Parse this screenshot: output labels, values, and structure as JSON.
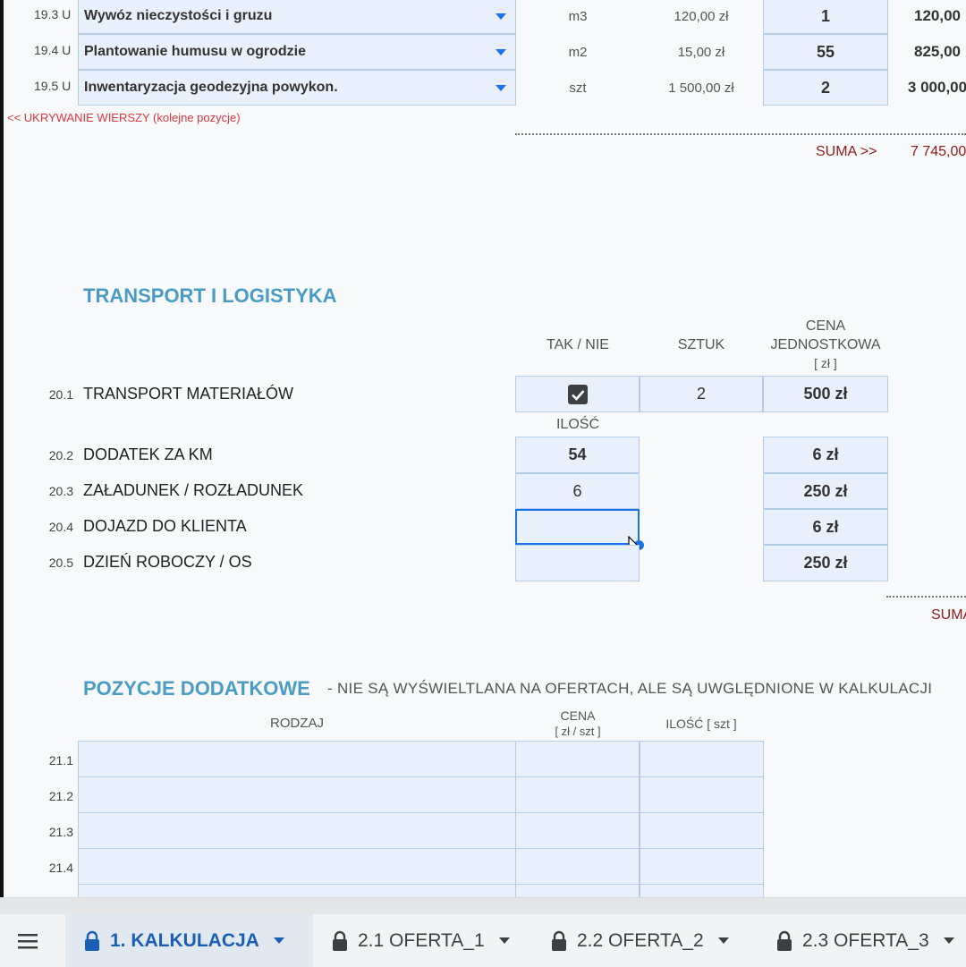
{
  "upper_rows": [
    {
      "num": "19.3 U",
      "name": "Wywóz nieczystości i gruzu",
      "unit": "m3",
      "price": "120,00 zł",
      "qty": "1",
      "total": "120,00"
    },
    {
      "num": "19.4 U",
      "name": "Plantowanie humusu w ogrodzie",
      "unit": "m2",
      "price": "15,00 zł",
      "qty": "55",
      "total": "825,00"
    },
    {
      "num": "19.5 U",
      "name": "Inwentaryzacja geodezyjna powykon.",
      "unit": "szt",
      "price": "1 500,00 zł",
      "qty": "2",
      "total": "3 000,00"
    }
  ],
  "hide_rows_label": "<< UKRYWANIE WIERSZY (kolejne pozycje)",
  "suma_label": "SUMA >>",
  "suma_value": "7 745,00",
  "transport": {
    "title": "TRANSPORT I LOGISTYKA",
    "col_tak_nie": "TAK / NIE",
    "col_sztuk": "SZTUK",
    "col_cena_1": "CENA",
    "col_cena_2": "JEDNOSTKOWA",
    "col_cena_3": "[ zł ]",
    "col_ilosc": "ILOŚĆ",
    "rows": [
      {
        "num": "20.1",
        "name": "TRANSPORT MATERIAŁÓW",
        "checked": true,
        "sztuk": "2",
        "cena": "500 zł"
      },
      {
        "num": "20.2",
        "name": "DODATEK ZA KM",
        "ilosc": "54",
        "cena": "6 zł"
      },
      {
        "num": "20.3",
        "name": "ZAŁADUNEK / ROZŁADUNEK",
        "ilosc": "6",
        "cena": "250 zł"
      },
      {
        "num": "20.4",
        "name": "DOJAZD DO KLIENTA",
        "ilosc": "",
        "cena": "6 zł"
      },
      {
        "num": "20.5",
        "name": "DZIEŃ ROBOCZY / OS",
        "ilosc": "",
        "cena": "250 zł"
      }
    ],
    "suma_label": "SUMA"
  },
  "extra": {
    "title": "POZYCJE DODATKOWE",
    "subtitle": "- NIE SĄ WYŚWIELTLANA NA OFERTACH, ALE SĄ UWGLĘDNIONE W KALKULACJI",
    "col_rodzaj": "RODZAJ",
    "col_cena_1": "CENA",
    "col_cena_2": "[ zł / szt ]",
    "col_ilosc": "ILOŚĆ [ szt ]",
    "row_nums": [
      "21.1",
      "21.2",
      "21.3",
      "21.4"
    ]
  },
  "tabs": [
    {
      "label": "1. KALKULACJA",
      "active": true
    },
    {
      "label": "2.1 OFERTA_1",
      "active": false
    },
    {
      "label": "2.2 OFERTA_2",
      "active": false
    },
    {
      "label": "2.3 OFERTA_3",
      "active": false
    }
  ],
  "colors": {
    "accent": "#1a73e8",
    "section": "#4a9cc4",
    "suma": "#8b1a1a",
    "cell": "#e8f1fb"
  }
}
